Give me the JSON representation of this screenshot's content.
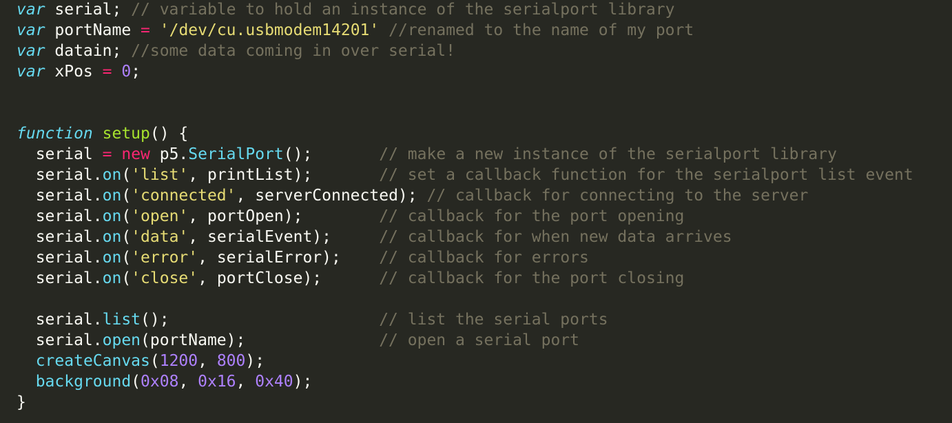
{
  "editor": {
    "theme": {
      "background": "#272822",
      "foreground": "#f8f8f2",
      "keyword_italic": "#66d9ef",
      "operator": "#f92672",
      "function_name": "#a6e22e",
      "string": "#e6db74",
      "number": "#ae81ff",
      "comment": "#75715e",
      "builtin_call": "#66d9ef"
    },
    "lines": [
      [
        {
          "t": "var",
          "c": "kw-i"
        },
        {
          "t": " serial; ",
          "c": "id"
        },
        {
          "t": "// variable to hold an instance of the serialport library",
          "c": "cm"
        }
      ],
      [
        {
          "t": "var",
          "c": "kw-i"
        },
        {
          "t": " portName ",
          "c": "id"
        },
        {
          "t": "=",
          "c": "kw"
        },
        {
          "t": " ",
          "c": "id"
        },
        {
          "t": "'/dev/cu.usbmodem14201'",
          "c": "str"
        },
        {
          "t": " ",
          "c": "id"
        },
        {
          "t": "//renamed to the name of my port",
          "c": "cm"
        }
      ],
      [
        {
          "t": "var",
          "c": "kw-i"
        },
        {
          "t": " datain; ",
          "c": "id"
        },
        {
          "t": "//some data coming in over serial!",
          "c": "cm"
        }
      ],
      [
        {
          "t": "var",
          "c": "kw-i"
        },
        {
          "t": " xPos ",
          "c": "id"
        },
        {
          "t": "=",
          "c": "kw"
        },
        {
          "t": " ",
          "c": "id"
        },
        {
          "t": "0",
          "c": "num"
        },
        {
          "t": ";",
          "c": "id"
        }
      ],
      [],
      [],
      [
        {
          "t": "function",
          "c": "kw-i"
        },
        {
          "t": " ",
          "c": "id"
        },
        {
          "t": "setup",
          "c": "fn"
        },
        {
          "t": "() {",
          "c": "id"
        }
      ],
      [
        {
          "t": "  serial ",
          "c": "id"
        },
        {
          "t": "=",
          "c": "kw"
        },
        {
          "t": " ",
          "c": "id"
        },
        {
          "t": "new",
          "c": "kw"
        },
        {
          "t": " p5.",
          "c": "id"
        },
        {
          "t": "SerialPort",
          "c": "call"
        },
        {
          "t": "();       ",
          "c": "id"
        },
        {
          "t": "// make a new instance of the serialport library",
          "c": "cm"
        }
      ],
      [
        {
          "t": "  serial.",
          "c": "id"
        },
        {
          "t": "on",
          "c": "call"
        },
        {
          "t": "(",
          "c": "id"
        },
        {
          "t": "'list'",
          "c": "str"
        },
        {
          "t": ", printList);       ",
          "c": "id"
        },
        {
          "t": "// set a callback function for the serialport list event",
          "c": "cm"
        }
      ],
      [
        {
          "t": "  serial.",
          "c": "id"
        },
        {
          "t": "on",
          "c": "call"
        },
        {
          "t": "(",
          "c": "id"
        },
        {
          "t": "'connected'",
          "c": "str"
        },
        {
          "t": ", serverConnected); ",
          "c": "id"
        },
        {
          "t": "// callback for connecting to the server",
          "c": "cm"
        }
      ],
      [
        {
          "t": "  serial.",
          "c": "id"
        },
        {
          "t": "on",
          "c": "call"
        },
        {
          "t": "(",
          "c": "id"
        },
        {
          "t": "'open'",
          "c": "str"
        },
        {
          "t": ", portOpen);        ",
          "c": "id"
        },
        {
          "t": "// callback for the port opening",
          "c": "cm"
        }
      ],
      [
        {
          "t": "  serial.",
          "c": "id"
        },
        {
          "t": "on",
          "c": "call"
        },
        {
          "t": "(",
          "c": "id"
        },
        {
          "t": "'data'",
          "c": "str"
        },
        {
          "t": ", serialEvent);     ",
          "c": "id"
        },
        {
          "t": "// callback for when new data arrives",
          "c": "cm"
        }
      ],
      [
        {
          "t": "  serial.",
          "c": "id"
        },
        {
          "t": "on",
          "c": "call"
        },
        {
          "t": "(",
          "c": "id"
        },
        {
          "t": "'error'",
          "c": "str"
        },
        {
          "t": ", serialError);    ",
          "c": "id"
        },
        {
          "t": "// callback for errors",
          "c": "cm"
        }
      ],
      [
        {
          "t": "  serial.",
          "c": "id"
        },
        {
          "t": "on",
          "c": "call"
        },
        {
          "t": "(",
          "c": "id"
        },
        {
          "t": "'close'",
          "c": "str"
        },
        {
          "t": ", portClose);      ",
          "c": "id"
        },
        {
          "t": "// callback for the port closing",
          "c": "cm"
        }
      ],
      [],
      [
        {
          "t": "  serial.",
          "c": "id"
        },
        {
          "t": "list",
          "c": "call"
        },
        {
          "t": "();                      ",
          "c": "id"
        },
        {
          "t": "// list the serial ports",
          "c": "cm"
        }
      ],
      [
        {
          "t": "  serial.",
          "c": "id"
        },
        {
          "t": "open",
          "c": "call"
        },
        {
          "t": "(portName);              ",
          "c": "id"
        },
        {
          "t": "// open a serial port",
          "c": "cm"
        }
      ],
      [
        {
          "t": "  ",
          "c": "id"
        },
        {
          "t": "createCanvas",
          "c": "call"
        },
        {
          "t": "(",
          "c": "id"
        },
        {
          "t": "1200",
          "c": "num"
        },
        {
          "t": ", ",
          "c": "id"
        },
        {
          "t": "800",
          "c": "num"
        },
        {
          "t": ");",
          "c": "id"
        }
      ],
      [
        {
          "t": "  ",
          "c": "id"
        },
        {
          "t": "background",
          "c": "call"
        },
        {
          "t": "(",
          "c": "id"
        },
        {
          "t": "0x08",
          "c": "num"
        },
        {
          "t": ", ",
          "c": "id"
        },
        {
          "t": "0x16",
          "c": "num"
        },
        {
          "t": ", ",
          "c": "id"
        },
        {
          "t": "0x40",
          "c": "num"
        },
        {
          "t": ");",
          "c": "id"
        }
      ],
      [
        {
          "t": "}",
          "c": "id"
        }
      ]
    ]
  }
}
